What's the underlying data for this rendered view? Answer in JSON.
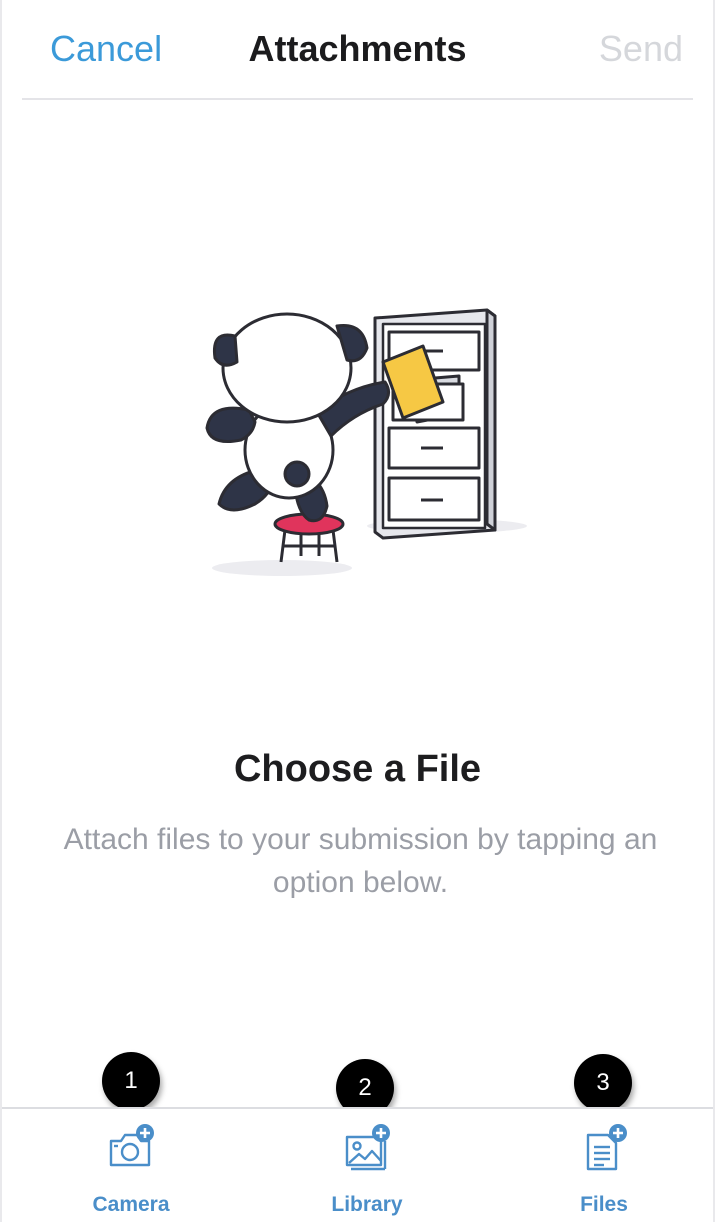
{
  "navbar": {
    "cancel_label": "Cancel",
    "title": "Attachments",
    "send_label": "Send"
  },
  "empty_state": {
    "illustration": "panda-filing-cabinet",
    "title": "Choose a File",
    "body": "Attach files to your submission by tapping an option below."
  },
  "toolbar": {
    "items": [
      {
        "label": "Camera",
        "icon": "camera-add-icon",
        "badge": "1"
      },
      {
        "label": "Library",
        "icon": "photo-library-add-icon",
        "badge": "2"
      },
      {
        "label": "Files",
        "icon": "document-add-icon",
        "badge": "3"
      }
    ]
  },
  "colors": {
    "accent": "#3b9ad9",
    "toolbar_label": "#4a8ec9",
    "send_disabled": "#d5d7db",
    "body_text": "#9b9ea6",
    "stool": "#e0345c"
  }
}
